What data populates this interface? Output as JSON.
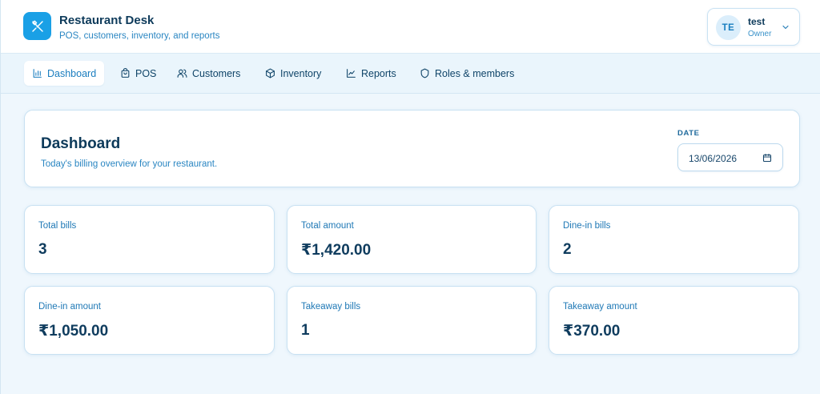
{
  "brand": {
    "title": "Restaurant Desk",
    "subtitle": "POS, customers, inventory, and reports",
    "logo_icon": "fork-knife-icon",
    "accent": "#1aa0e6"
  },
  "user": {
    "initials": "TE",
    "name": "test",
    "role": "Owner"
  },
  "nav": {
    "items": [
      {
        "label": "Dashboard",
        "icon": "bar-chart-icon",
        "active": true
      },
      {
        "label": "POS",
        "icon": "shopping-bag-icon",
        "active": false
      },
      {
        "label": "Customers",
        "icon": "users-icon",
        "active": false
      },
      {
        "label": "Inventory",
        "icon": "box-icon",
        "active": false
      },
      {
        "label": "Reports",
        "icon": "line-chart-icon",
        "active": false
      },
      {
        "label": "Roles & members",
        "icon": "shield-icon",
        "active": false
      }
    ]
  },
  "dashboard": {
    "title": "Dashboard",
    "subtitle": "Today's billing overview for your restaurant.",
    "date_label": "DATE",
    "date_value": "13/06/2026"
  },
  "stats": [
    {
      "label": "Total bills",
      "value": "3"
    },
    {
      "label": "Total amount",
      "value": "₹1,420.00"
    },
    {
      "label": "Dine-in bills",
      "value": "2"
    },
    {
      "label": "Dine-in amount",
      "value": "₹1,050.00"
    },
    {
      "label": "Takeaway bills",
      "value": "1"
    },
    {
      "label": "Takeaway amount",
      "value": "₹370.00"
    }
  ]
}
